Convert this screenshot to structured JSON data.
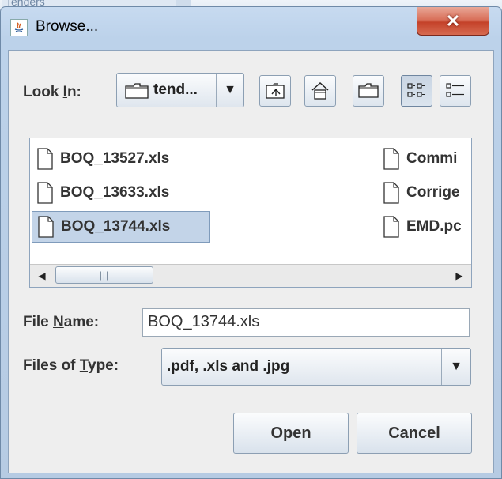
{
  "background": {
    "tab_label": "Tenders"
  },
  "window": {
    "title": "Browse...",
    "close_glyph": "✕"
  },
  "look_in": {
    "label_pre": "Look ",
    "label_key": "I",
    "label_post": "n:",
    "value": "tend...",
    "icon": "folder-icon"
  },
  "toolbar": {
    "buttons": [
      {
        "name": "up-one-level-button",
        "icon": "folder-up-icon"
      },
      {
        "name": "home-button",
        "icon": "home-icon"
      },
      {
        "name": "new-folder-button",
        "icon": "new-folder-icon"
      },
      {
        "name": "list-view-button",
        "icon": "list-view-icon",
        "pressed": true
      },
      {
        "name": "details-view-button",
        "icon": "details-view-icon"
      }
    ]
  },
  "files": {
    "column1": [
      "BOQ_13527.xls",
      "BOQ_13633.xls",
      "BOQ_13744.xls"
    ],
    "column2": [
      "Commi",
      "Corrige",
      "EMD.pc"
    ],
    "selected": "BOQ_13744.xls"
  },
  "scrollbar": {
    "thumb_grip": "|||"
  },
  "file_name": {
    "label_pre": "File ",
    "label_key": "N",
    "label_post": "ame:",
    "value": "BOQ_13744.xls"
  },
  "file_type": {
    "label_pre": "Files of ",
    "label_key": "T",
    "label_post": "ype:",
    "value": ".pdf, .xls and .jpg"
  },
  "buttons": {
    "open": "Open",
    "cancel": "Cancel"
  },
  "colors": {
    "selection": "#c3d4e8",
    "close": "#c4422a"
  }
}
